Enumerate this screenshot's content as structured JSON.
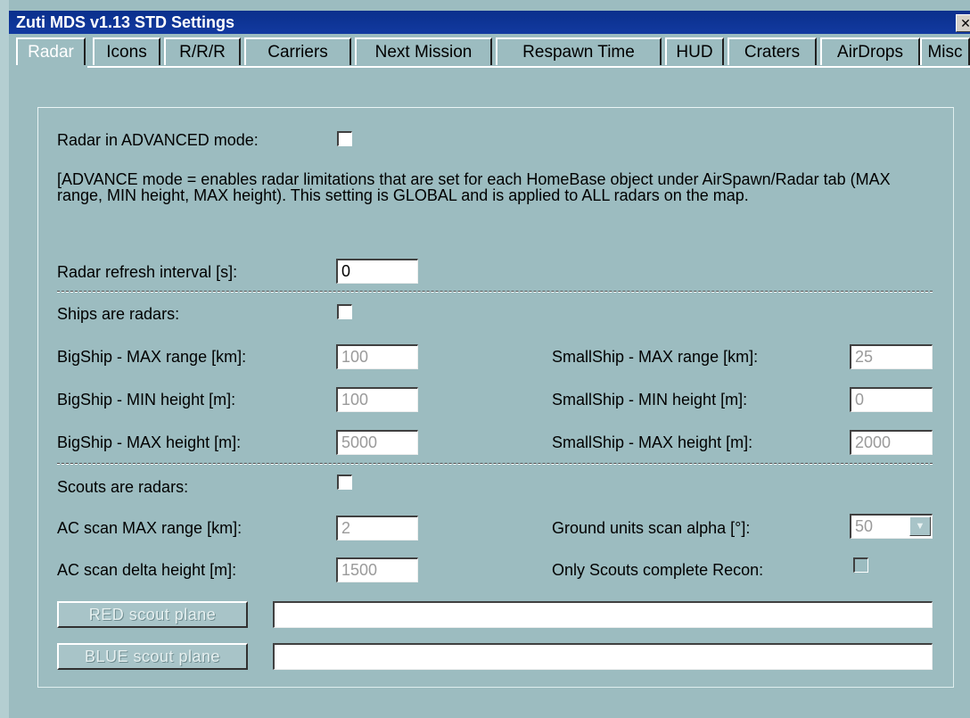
{
  "window": {
    "title": "Zuti MDS v1.13 STD Settings",
    "close_glyph": "✕"
  },
  "tabs": [
    {
      "label": "Radar",
      "active": true
    },
    {
      "label": "Icons"
    },
    {
      "label": "R/R/R"
    },
    {
      "label": "Carriers"
    },
    {
      "label": "Next Mission"
    },
    {
      "label": "Respawn Time"
    },
    {
      "label": "HUD"
    },
    {
      "label": "Craters"
    },
    {
      "label": "AirDrops"
    },
    {
      "label": "Misc"
    }
  ],
  "radar": {
    "advanced_label": "Radar in ADVANCED mode:",
    "advanced_checked": false,
    "advanced_description": "[ADVANCE mode = enables radar limitations that are set for each HomeBase object under AirSpawn/Radar tab (MAX range, MIN height, MAX height). This setting is GLOBAL and is applied to ALL radars on the map.",
    "refresh_label": "Radar refresh interval [s]:",
    "refresh_value": "0"
  },
  "ships": {
    "label": "Ships are radars:",
    "checked": false,
    "big_max_range_label": "BigShip - MAX range [km]:",
    "big_max_range_value": "100",
    "big_min_height_label": "BigShip - MIN height [m]:",
    "big_min_height_value": "100",
    "big_max_height_label": "BigShip - MAX height [m]:",
    "big_max_height_value": "5000",
    "small_max_range_label": "SmallShip - MAX range [km]:",
    "small_max_range_value": "25",
    "small_min_height_label": "SmallShip - MIN height [m]:",
    "small_min_height_value": "0",
    "small_max_height_label": "SmallShip - MAX height [m]:",
    "small_max_height_value": "2000"
  },
  "scouts": {
    "label": "Scouts are radars:",
    "checked": false,
    "ac_max_range_label": "AC scan MAX range [km]:",
    "ac_max_range_value": "2",
    "ac_delta_height_label": "AC scan delta height [m]:",
    "ac_delta_height_value": "1500",
    "ground_alpha_label": "Ground units scan alpha [°]:",
    "ground_alpha_value": "50",
    "only_scouts_label": "Only Scouts complete Recon:",
    "only_scouts_checked": false,
    "red_button": "RED scout plane",
    "red_value": "",
    "blue_button": "BLUE scout plane",
    "blue_value": ""
  },
  "icons": {
    "close": "close-icon",
    "dropdown": "chevron-down-icon"
  }
}
